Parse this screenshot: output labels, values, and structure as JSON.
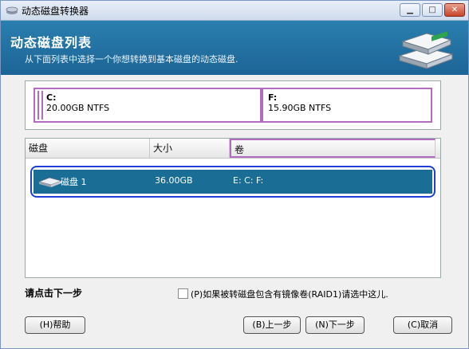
{
  "window": {
    "title": "动态磁盘转换器"
  },
  "header": {
    "title": "动态磁盘列表",
    "subtitle": "从下面列表中选择一个你想转换到基本磁盘的动态磁盘."
  },
  "volumes": [
    {
      "name": "C:",
      "size": "20.00GB NTFS"
    },
    {
      "name": "F:",
      "size": "15.90GB NTFS"
    }
  ],
  "list": {
    "columns": [
      "磁盘",
      "大小",
      "卷"
    ],
    "rows": [
      {
        "disk": "磁盘 1",
        "size": "36.00GB",
        "volumes": "E:  C:  F:"
      }
    ]
  },
  "footer": {
    "hint": "请点击下一步",
    "raid_checkbox_label": "(P)如果被转磁盘包含有镜像卷(RAID1)请选中这儿.",
    "raid_checked": false
  },
  "buttons": {
    "help": "(H)帮助",
    "back": "(B)上一步",
    "next": "(N)下一步",
    "cancel": "(C)取消"
  },
  "colors": {
    "header": "#1c6496",
    "selected_row": "#1a6e96",
    "volume_border": "#b36cc0",
    "highlight_outline": "#1f3fd8"
  }
}
